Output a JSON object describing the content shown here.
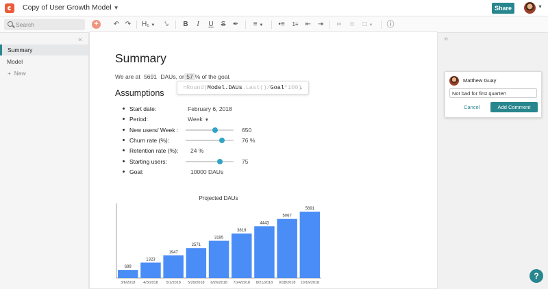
{
  "header": {
    "doc_title": "Copy of User Growth Model",
    "share_label": "Share"
  },
  "toolbar": {
    "search_placeholder": "Search",
    "heading_label": "H₁"
  },
  "sidebar": {
    "items": [
      {
        "label": "Summary",
        "active": true
      },
      {
        "label": "Model",
        "active": false
      }
    ],
    "new_label": "New"
  },
  "doc": {
    "title": "Summary",
    "sentence": {
      "prefix": "We are at",
      "daus": "5691",
      "mid": "DAUs, or",
      "pct": "57",
      "suffix": "% of the goal."
    },
    "formula": {
      "pre": "=Round(",
      "ref": "Model.DAUs",
      "mid": ".Last()/",
      "goal": "Goal",
      "post": "*100)"
    },
    "assumptions_title": "Assumptions",
    "assumptions": {
      "start_date": {
        "label": "Start date:",
        "value": "February 6, 2018"
      },
      "period": {
        "label": "Period:",
        "value": "Week"
      },
      "new_users": {
        "label": "New users/ Week :",
        "value": "650",
        "fraction": 0.62
      },
      "churn": {
        "label": "Churn rate (%):",
        "value": "76 %",
        "fraction": 0.75
      },
      "retention": {
        "label": "Retention rate (%):",
        "value": "24 %"
      },
      "starting_users": {
        "label": "Starting users:",
        "value": "75",
        "fraction": 0.72
      },
      "goal": {
        "label": "Goal:",
        "value": "10000 DAUs"
      }
    }
  },
  "chart_data": {
    "type": "bar",
    "title": "Projected DAUs",
    "categories": [
      "3/6/2018",
      "4/3/2018",
      "5/1/2018",
      "5/29/2018",
      "6/26/2018",
      "7/24/2018",
      "8/21/2018",
      "9/18/2018",
      "10/16/2018"
    ],
    "values": [
      699,
      1323,
      1947,
      2571,
      3195,
      3819,
      4443,
      5067,
      5691
    ],
    "color": "#4a8df7",
    "ylim": [
      0,
      6400
    ],
    "grid": false
  },
  "comment": {
    "author": "Matthew Guay",
    "text": "Not bad for first quarter!",
    "cancel_label": "Cancel",
    "add_label": "Add Comment"
  },
  "help_label": "?"
}
